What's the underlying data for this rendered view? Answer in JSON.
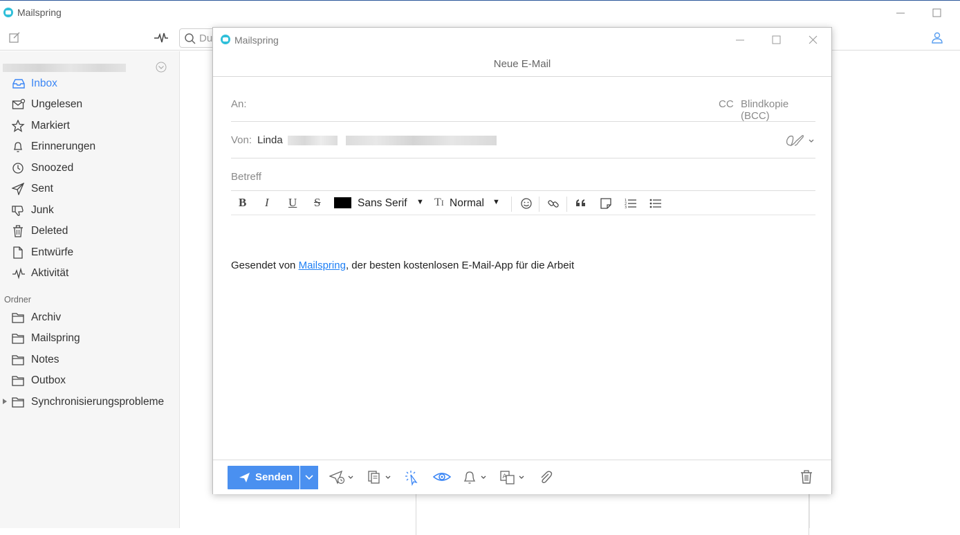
{
  "app": {
    "title": "Mailspring"
  },
  "toolbar": {
    "search_placeholder": "Du"
  },
  "sidebar": {
    "items": [
      {
        "label": "Inbox",
        "icon": "inbox-icon",
        "active": true
      },
      {
        "label": "Ungelesen",
        "icon": "unread-icon"
      },
      {
        "label": "Markiert",
        "icon": "star-icon"
      },
      {
        "label": "Erinnerungen",
        "icon": "bell-icon"
      },
      {
        "label": "Snoozed",
        "icon": "clock-icon"
      },
      {
        "label": "Sent",
        "icon": "send-icon"
      },
      {
        "label": "Junk",
        "icon": "thumbs-down-icon"
      },
      {
        "label": "Deleted",
        "icon": "trash-icon"
      },
      {
        "label": "Entwürfe",
        "icon": "draft-icon"
      },
      {
        "label": "Aktivität",
        "icon": "activity-icon"
      }
    ],
    "folders_heading": "Ordner",
    "folders": [
      {
        "label": "Archiv",
        "icon": "folder-icon"
      },
      {
        "label": "Mailspring",
        "icon": "folder-icon"
      },
      {
        "label": "Notes",
        "icon": "folder-icon"
      },
      {
        "label": "Outbox",
        "icon": "folder-icon"
      },
      {
        "label": "Synchronisierungsprobleme",
        "icon": "folder-icon",
        "expandable": true
      }
    ]
  },
  "compose": {
    "window_title": "Mailspring",
    "heading": "Neue E-Mail",
    "to_label": "An:",
    "cc_label": "CC",
    "bcc_label": "Blindkopie (BCC)",
    "from_label": "Von:",
    "from_name": "Linda",
    "subject_placeholder": "Betreff",
    "format": {
      "bold": "B",
      "italic": "I",
      "underline": "U",
      "strike": "S",
      "text_color": "#000000",
      "font": "Sans Serif",
      "size_icon": "T1",
      "size": "Normal",
      "caret": "▼"
    },
    "body": {
      "prefix": "Gesendet von ",
      "link": "Mailspring",
      "suffix": ", der besten kostenlosen E-Mail-App für die Arbeit"
    },
    "send_label": "Senden",
    "accent_color": "#4a90f0"
  }
}
